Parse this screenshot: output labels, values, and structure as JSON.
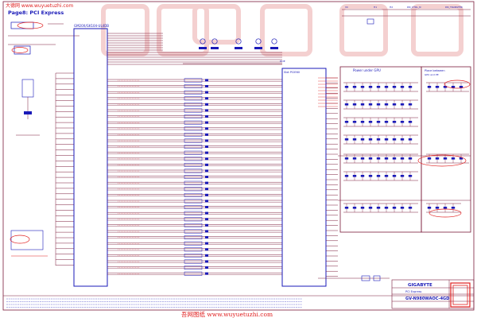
{
  "page_title": "Page8: PCI Express",
  "top_stamp": "大德网 www.wuyuetuzhi.com",
  "gpu_part": "GM20X/GK104-UL4DB",
  "right_ic_title": "Slot PCIE60",
  "power_under_gpu": "Power under GPU",
  "near_bottom_gpu": "Place between",
  "near_bottom_gpu_sub": "GPU and PE",
  "top_right_headers": [
    "VC",
    "H1",
    "H2",
    "DN_CTRL_N",
    "DN_TRANSFER"
  ],
  "logo": "GIGABYTE",
  "title_block": {
    "title": "PCI Express",
    "doc_no": "GV-N980WAOC-4GD"
  },
  "bottom_watermark": "吾网图纸 www.wuyuetuzhi.com",
  "colors": {
    "wire": "#7a1b3a",
    "component": "#1a1ab8",
    "accent": "#e02020",
    "grid": "#f6dada"
  }
}
